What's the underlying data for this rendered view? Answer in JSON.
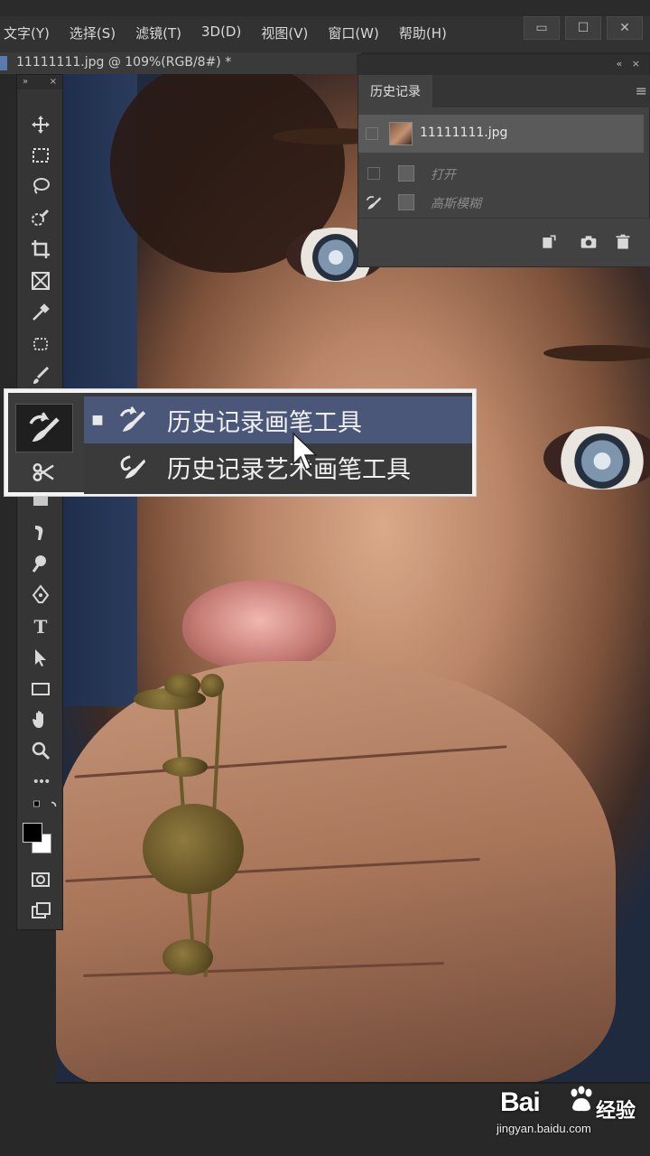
{
  "menubar": {
    "items": [
      "文字(Y)",
      "选择(S)",
      "滤镜(T)",
      "3D(D)",
      "视图(V)",
      "窗口(W)",
      "帮助(H)"
    ],
    "window_buttons": [
      "▭",
      "☐",
      "✕"
    ]
  },
  "document": {
    "tab_title": "11111111.jpg @ 109%(RGB/8#) *"
  },
  "toolbar": {
    "header_left": "»",
    "header_right": "×",
    "tools": [
      "move-icon",
      "marquee-icon",
      "lasso-icon",
      "quick-select-icon",
      "crop-icon",
      "frame-icon",
      "eyedropper-icon",
      "patch-icon",
      "brush-icon",
      "history-brush-icon",
      "clone-stamp-icon",
      "eraser-icon",
      "smudge-icon",
      "dodge-icon",
      "pen-icon",
      "type-icon",
      "path-select-icon",
      "rectangle-icon",
      "hand-icon",
      "zoom-icon",
      "more-icon",
      "quickmask-icon",
      "screenmode-icon"
    ],
    "type_glyph": "T",
    "more_glyph": "•••"
  },
  "history_panel": {
    "collapse_glyph": "«",
    "close_glyph": "×",
    "tab_label": "历史记录",
    "menu_glyph": "≡",
    "snapshot_name": "11111111.jpg",
    "steps": [
      "打开",
      "高斯模糊"
    ],
    "footer_buttons": [
      "new-document-icon",
      "camera-icon",
      "trash-icon"
    ]
  },
  "flyout": {
    "items": [
      {
        "label": "历史记录画笔工具",
        "shortcut": "",
        "selected": true,
        "bullet": "■"
      },
      {
        "label": "历史记录艺术画笔工具",
        "shortcut": "",
        "selected": false,
        "bullet": ""
      }
    ]
  },
  "watermark": {
    "brand": "Bai",
    "brand_suffix": "经验",
    "url": "jingyan.baidu.com"
  }
}
